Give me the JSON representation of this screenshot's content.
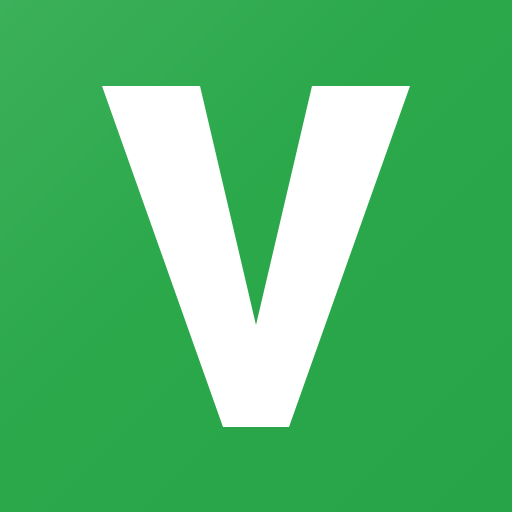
{
  "app_icon": {
    "letter": "V",
    "background_color": "#2aa84a",
    "glyph_color": "#ffffff",
    "icon_name": "v-letter-logo-icon"
  }
}
